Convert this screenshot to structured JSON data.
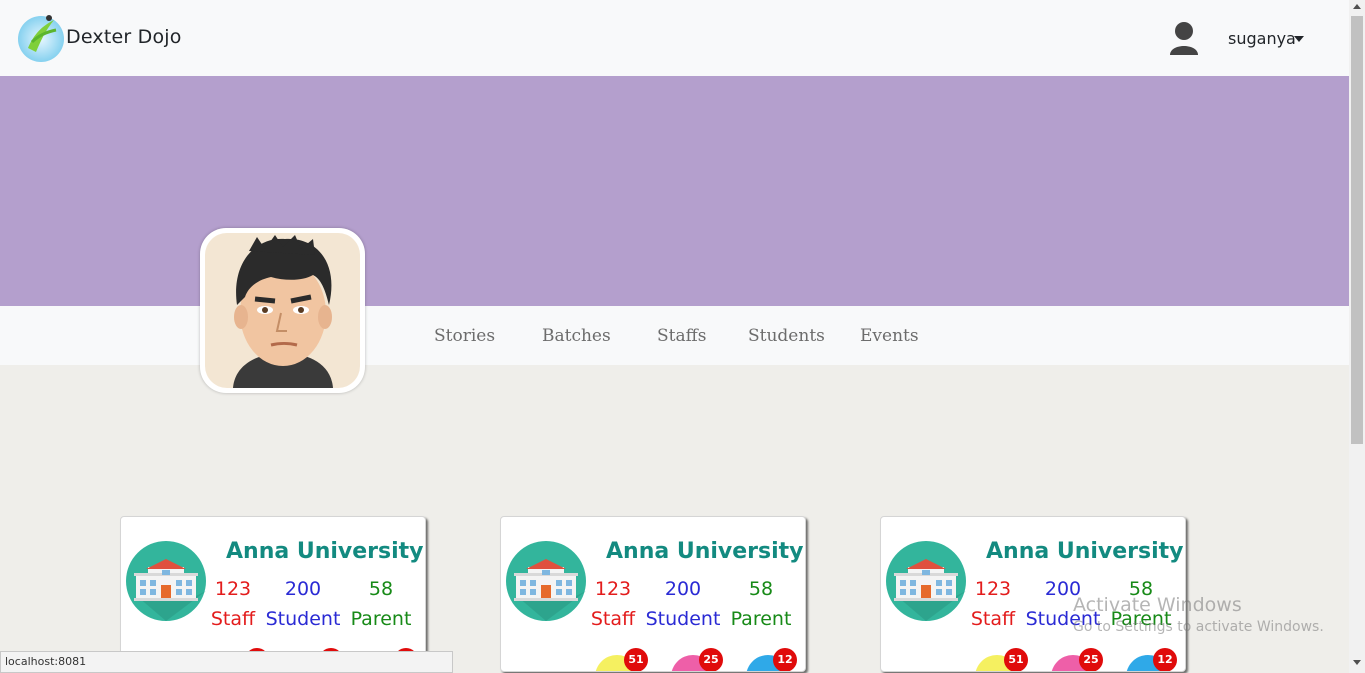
{
  "navbar": {
    "brand": "Dexter Dojo",
    "user": "suganya"
  },
  "tabs": [
    "Stories",
    "Batches",
    "Staffs",
    "Students",
    "Events"
  ],
  "cards": [
    {
      "title": "Anna University",
      "staff_count": "123",
      "staff_label": "Staff",
      "student_count": "200",
      "student_label": "Student",
      "parent_count": "58",
      "parent_label": "Parent",
      "badges": [
        "",
        "",
        ""
      ]
    },
    {
      "title": "Anna University",
      "staff_count": "123",
      "staff_label": "Staff",
      "student_count": "200",
      "student_label": "Student",
      "parent_count": "58",
      "parent_label": "Parent",
      "badges": [
        "51",
        "25",
        "12"
      ]
    },
    {
      "title": "Anna University",
      "staff_count": "123",
      "staff_label": "Staff",
      "student_count": "200",
      "student_label": "Student",
      "parent_count": "58",
      "parent_label": "Parent",
      "badges": [
        "51",
        "25",
        "12"
      ]
    }
  ],
  "watermark": {
    "title": "Activate Windows",
    "subtitle": "Go to Settings to activate Windows."
  },
  "statusbar": {
    "url": "localhost:8081"
  },
  "colors": {
    "banner": "#b49fcd",
    "title": "#138a80",
    "staff": "#e31c1c",
    "student": "#2a2ad4",
    "parent": "#178a17",
    "badge": "#e00b0b"
  },
  "icons": {
    "brand": "dexter-dojo-logo",
    "user": "user-silhouette-icon",
    "card": "school-building-icon",
    "mini": [
      "news-icon",
      "heart-icon",
      "user-icon"
    ]
  }
}
